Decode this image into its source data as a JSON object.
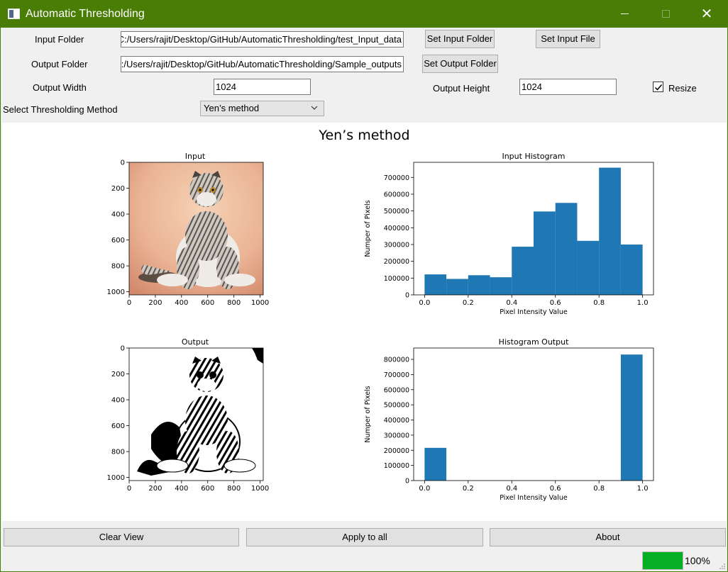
{
  "window": {
    "title": "Automatic Thresholding",
    "accent": "#4a7d06"
  },
  "form": {
    "input_folder_label": "Input Folder",
    "input_folder_value": "C:/Users/rajit/Desktop/GitHub/AutomaticThresholding/test_Input_data",
    "set_input_folder": "Set Input Folder",
    "set_input_file": "Set Input File",
    "output_folder_label": "Output Folder",
    "output_folder_value": "C:/Users/rajit/Desktop/GitHub/AutomaticThresholding/Sample_outputs",
    "set_output_folder": "Set Output Folder",
    "output_width_label": "Output Width",
    "output_width_value": "1024",
    "output_height_label": "Output Height",
    "output_height_value": "1024",
    "resize_label": "Resize",
    "resize_checked": true,
    "method_label": "Select Thresholding Method",
    "method_value": "Yen’s method"
  },
  "figure": {
    "title": "Yen’s method",
    "input_image_title": "Input",
    "output_image_title": "Output",
    "image_ticks": [
      "0",
      "200",
      "400",
      "600",
      "800",
      "1000"
    ]
  },
  "chart_data": [
    {
      "type": "bar",
      "title": "Input Histogram",
      "xlabel": "Pixel Intensity Value",
      "ylabel": "Numper of Pixels",
      "bins": [
        0.0,
        0.1,
        0.2,
        0.3,
        0.4,
        0.5,
        0.6,
        0.7,
        0.8,
        0.9,
        1.0
      ],
      "values": [
        122000,
        95000,
        117000,
        105000,
        287000,
        497000,
        548000,
        322000,
        758000,
        300000
      ],
      "xlim": [
        -0.05,
        1.05
      ],
      "ylim": [
        0,
        790000
      ],
      "xticks": [
        "0.0",
        "0.2",
        "0.4",
        "0.6",
        "0.8",
        "1.0"
      ],
      "yticks": [
        "0",
        "100000",
        "200000",
        "300000",
        "400000",
        "500000",
        "600000",
        "700000"
      ],
      "color": "#1f77b4"
    },
    {
      "type": "bar",
      "title": "Histogram Output",
      "xlabel": "Pixel Intensity Value",
      "ylabel": "Numper of Pixels",
      "bins": [
        0.0,
        0.1,
        0.2,
        0.3,
        0.4,
        0.5,
        0.6,
        0.7,
        0.8,
        0.9,
        1.0
      ],
      "values": [
        216000,
        0,
        0,
        0,
        0,
        0,
        0,
        0,
        0,
        832000
      ],
      "xlim": [
        -0.05,
        1.05
      ],
      "ylim": [
        0,
        875000
      ],
      "xticks": [
        "0.0",
        "0.2",
        "0.4",
        "0.6",
        "0.8",
        "1.0"
      ],
      "yticks": [
        "0",
        "100000",
        "200000",
        "300000",
        "400000",
        "500000",
        "600000",
        "700000",
        "800000"
      ],
      "color": "#1f77b4"
    }
  ],
  "footer": {
    "clear_view": "Clear View",
    "apply_all": "Apply to all",
    "about": "About",
    "progress_value": 100,
    "progress_text": "100%",
    "progress_color": "#06b025"
  }
}
